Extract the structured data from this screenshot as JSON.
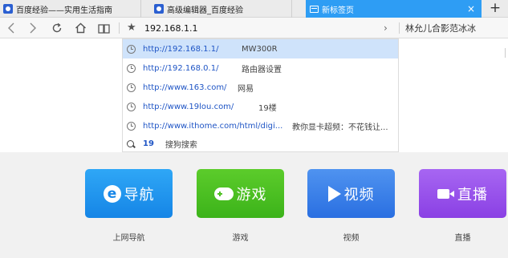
{
  "tabs": [
    {
      "title": "百度经验——实用生活指南",
      "icon": "baidu-paw-icon",
      "active": false
    },
    {
      "title": "高级编辑器_百度经验",
      "icon": "baidu-paw-icon",
      "active": true
    },
    {
      "title": "新标签页",
      "icon": "new-tab-icon",
      "active": true
    }
  ],
  "tab_close": "×",
  "tab_add": "+",
  "toolbar": {
    "back": "‹",
    "forward": "›",
    "reload": "↻",
    "home": "⌂",
    "reader": "▯▯",
    "bookmark_star": "★",
    "address_value": "192.168.1.1",
    "go_arrow": "›",
    "search_value": "林允儿合影范冰冰"
  },
  "suggestions": [
    {
      "url": "http://192.168.1.1/",
      "title": "MW300R",
      "selected": true
    },
    {
      "url": "http://192.168.0.1/",
      "title": "路由器设置",
      "selected": false
    },
    {
      "url": "http://www.163.com/",
      "title": "网易",
      "selected": false
    },
    {
      "url": "http://www.19lou.com/",
      "title": "19楼",
      "selected": false
    },
    {
      "url": "http://www.ithome.com/html/digi...",
      "title": "教你显卡超频：不花钱让...",
      "selected": false
    }
  ],
  "search_suggestion": {
    "query": "19",
    "engine_label": "搜狗搜索"
  },
  "speed_dial": [
    {
      "tile_text": "导航",
      "label": "上网导航",
      "icon": "e-nav-icon",
      "color": "#1a8ae8"
    },
    {
      "tile_text": "游戏",
      "label": "游戏",
      "icon": "gamepad-icon",
      "color": "#46b820"
    },
    {
      "tile_text": "视频",
      "label": "视频",
      "icon": "play-icon",
      "color": "#3479e6"
    },
    {
      "tile_text": "直播",
      "label": "直播",
      "icon": "camera-icon",
      "color": "#9448e8"
    }
  ],
  "colors": {
    "active_tab": "#2e9df4",
    "link": "#1f55c5",
    "selected_row": "#cfe3fb"
  }
}
